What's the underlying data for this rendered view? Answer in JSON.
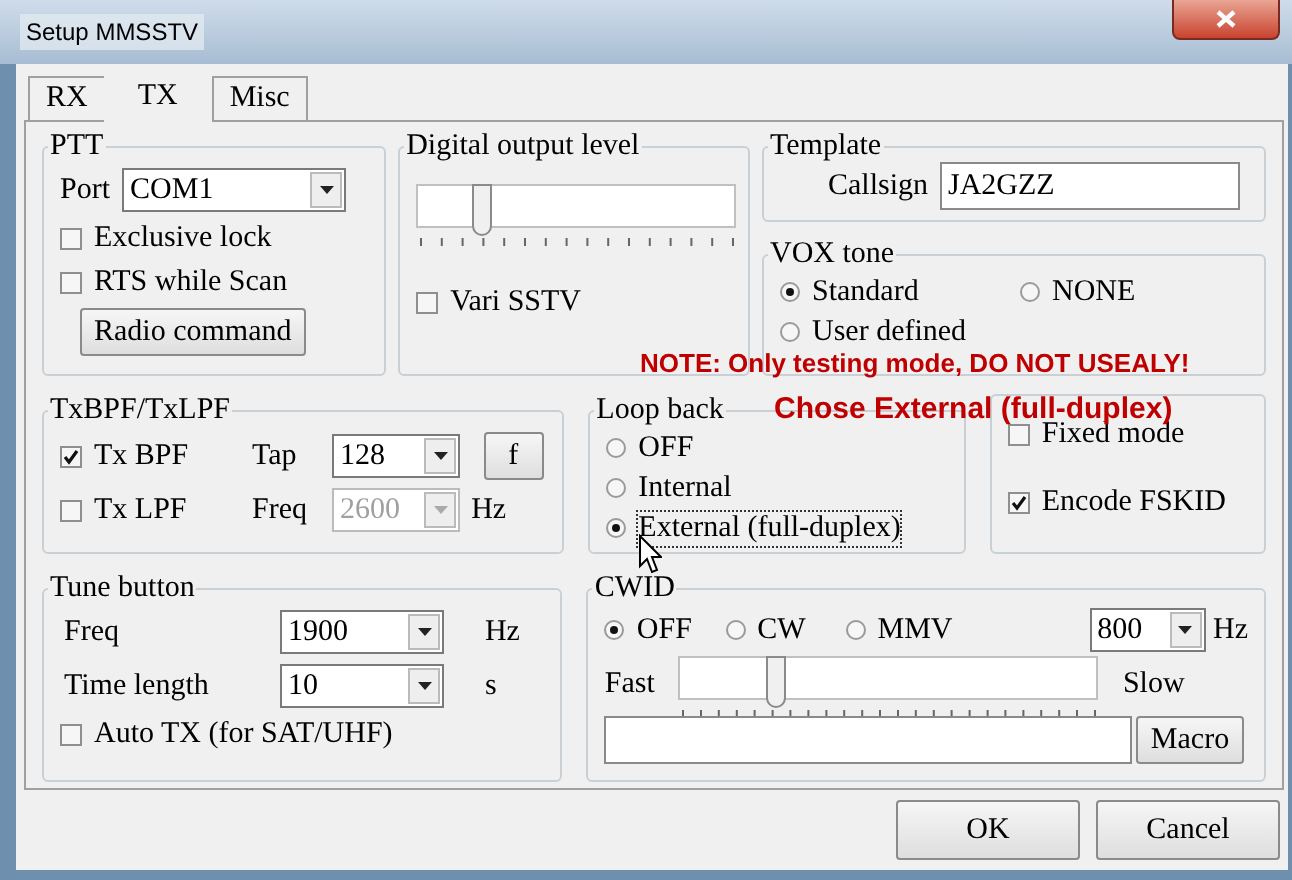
{
  "window": {
    "title": "Setup MMSSTV"
  },
  "tabs": [
    {
      "label": "RX",
      "selected": false
    },
    {
      "label": "TX",
      "selected": true
    },
    {
      "label": "Misc",
      "selected": false
    }
  ],
  "ptt": {
    "title": "PTT",
    "port_label": "Port",
    "port": {
      "value": "COM1"
    },
    "exclusive_lock": {
      "label": "Exclusive lock",
      "checked": false
    },
    "rts_while_scan": {
      "label": "RTS while Scan",
      "checked": false
    },
    "radio_command": "Radio command"
  },
  "digital_output_level": {
    "title": "Digital output level",
    "level": 0.2,
    "vari_sstv": {
      "label": "Vari SSTV",
      "checked": false
    }
  },
  "template": {
    "title": "Template",
    "callsign_label": "Callsign",
    "callsign": "JA2GZZ"
  },
  "vox_tone": {
    "title": "VOX tone",
    "options": [
      {
        "label": "Standard",
        "selected": true
      },
      {
        "label": "NONE",
        "selected": false
      },
      {
        "label": "User defined",
        "selected": false
      }
    ]
  },
  "annotations": [
    "NOTE: Only testing mode, DO NOT USEALY!",
    "Chose External (full-duplex)"
  ],
  "txbpf": {
    "title": "TxBPF/TxLPF",
    "tx_bpf": {
      "label": "Tx BPF",
      "checked": true
    },
    "tap_label": "Tap",
    "tap": {
      "value": "128"
    },
    "f_button": "f",
    "tx_lpf": {
      "label": "Tx LPF",
      "checked": false
    },
    "freq_label": "Freq",
    "freq": {
      "value": "2600",
      "disabled": true
    },
    "freq_unit": "Hz"
  },
  "loop_back": {
    "title": "Loop back",
    "options": [
      {
        "label": "OFF",
        "selected": false,
        "focused": false
      },
      {
        "label": "Internal",
        "selected": false,
        "focused": false
      },
      {
        "label": "External (full-duplex)",
        "selected": true,
        "focused": true
      }
    ]
  },
  "options": {
    "fixed_mode": {
      "label": "Fixed mode",
      "checked": false
    },
    "encode_fskid": {
      "label": "Encode FSKID",
      "checked": true
    }
  },
  "tune_button": {
    "title": "Tune button",
    "freq_label": "Freq",
    "freq": {
      "value": "1900"
    },
    "freq_unit": "Hz",
    "time_label": "Time length",
    "time": {
      "value": "10"
    },
    "time_unit": "s",
    "auto_tx": {
      "label": "Auto TX (for SAT/UHF)",
      "checked": false
    }
  },
  "cwid": {
    "title": "CWID",
    "options": [
      {
        "label": "OFF",
        "selected": true
      },
      {
        "label": "CW",
        "selected": false
      },
      {
        "label": "MMV",
        "selected": false
      }
    ],
    "tone": {
      "value": "800"
    },
    "tone_unit": "Hz",
    "fast_label": "Fast",
    "slow_label": "Slow",
    "level": 0.23,
    "macro": "Macro"
  },
  "buttons": [
    "OK",
    "Cancel"
  ]
}
